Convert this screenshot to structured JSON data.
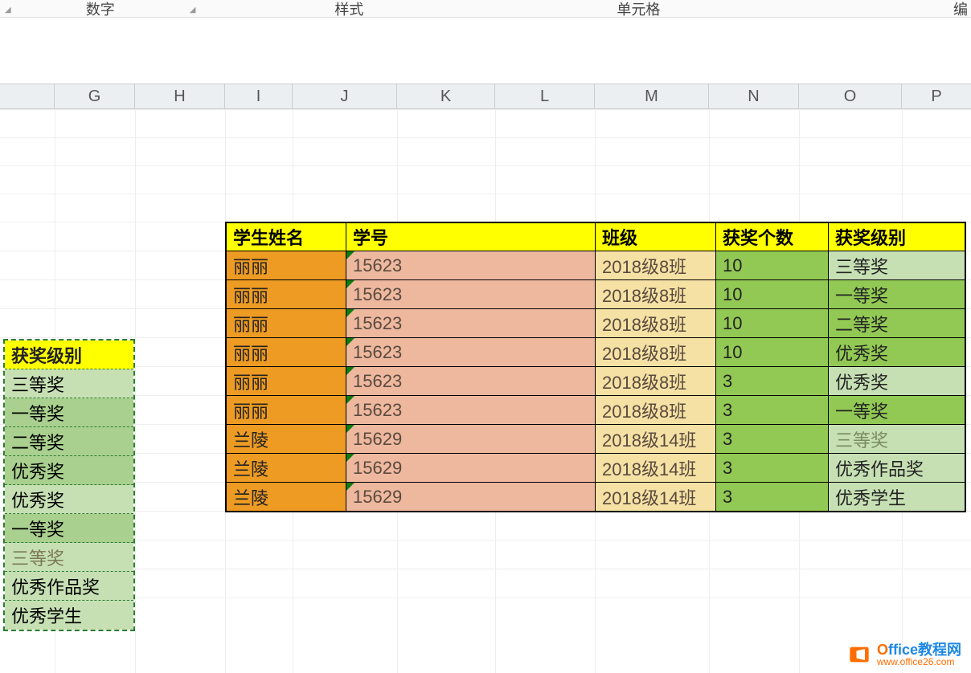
{
  "ribbon": {
    "number_group": "数字",
    "styles_group": "样式",
    "cells_group": "单元格",
    "editing_group": "编"
  },
  "columns": [
    "G",
    "H",
    "I",
    "J",
    "K",
    "L",
    "M",
    "N",
    "O",
    "P"
  ],
  "left_table": {
    "header": "获奖级别",
    "rows": [
      "三等奖",
      "一等奖",
      "二等奖",
      "优秀奖",
      "优秀奖",
      "一等奖",
      "三等奖",
      "优秀作品奖",
      "优秀学生"
    ]
  },
  "main_table": {
    "headers": {
      "name": "学生姓名",
      "id": "学号",
      "class": "班级",
      "count": "获奖个数",
      "award": "获奖级别"
    },
    "rows": [
      {
        "name": "丽丽",
        "id": "15623",
        "class": "2018级8班",
        "count": "10",
        "award": "三等奖"
      },
      {
        "name": "丽丽",
        "id": "15623",
        "class": "2018级8班",
        "count": "10",
        "award": "一等奖"
      },
      {
        "name": "丽丽",
        "id": "15623",
        "class": "2018级8班",
        "count": "10",
        "award": "二等奖"
      },
      {
        "name": "丽丽",
        "id": "15623",
        "class": "2018级8班",
        "count": "10",
        "award": "优秀奖"
      },
      {
        "name": "丽丽",
        "id": "15623",
        "class": "2018级8班",
        "count": "3",
        "award": "优秀奖"
      },
      {
        "name": "丽丽",
        "id": "15623",
        "class": "2018级8班",
        "count": "3",
        "award": "一等奖"
      },
      {
        "name": "兰陵",
        "id": "15629",
        "class": "2018级14班",
        "count": "3",
        "award": "三等奖"
      },
      {
        "name": "兰陵",
        "id": "15629",
        "class": "2018级14班",
        "count": "3",
        "award": "优秀作品奖"
      },
      {
        "name": "兰陵",
        "id": "15629",
        "class": "2018级14班",
        "count": "3",
        "award": "优秀学生"
      }
    ]
  },
  "watermark": {
    "line1": "Office教程网",
    "line2": "www.office26.com"
  }
}
